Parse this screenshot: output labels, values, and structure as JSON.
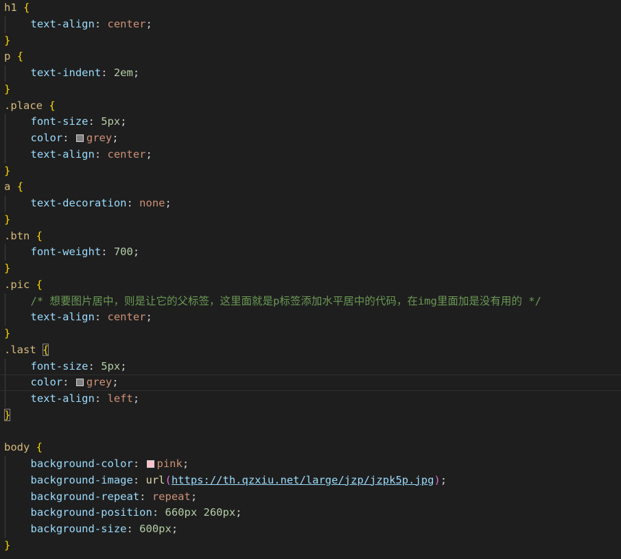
{
  "editor": {
    "swatch_colors": {
      "grey": "#808080",
      "pink": "#ffc0cb"
    },
    "lines": {
      "l1": {
        "sel": "h1",
        "brace": "{"
      },
      "l2": {
        "prop": "text-align",
        "colon": ":",
        "value": "center",
        "semi": ";"
      },
      "l3": {
        "brace": "}"
      },
      "l4": {
        "sel": "p",
        "brace": "{"
      },
      "l5": {
        "prop": "text-indent",
        "colon": ":",
        "value": "2em",
        "semi": ";"
      },
      "l6": {
        "brace": "}"
      },
      "l7": {
        "sel": ".place",
        "brace": "{"
      },
      "l8": {
        "prop": "font-size",
        "colon": ":",
        "value": "5px",
        "semi": ";"
      },
      "l9": {
        "prop": "color",
        "colon": ":",
        "value": "grey",
        "semi": ";"
      },
      "l10": {
        "prop": "text-align",
        "colon": ":",
        "value": "center",
        "semi": ";"
      },
      "l11": {
        "brace": "}"
      },
      "l12": {
        "sel": "a",
        "brace": "{"
      },
      "l13": {
        "prop": "text-decoration",
        "colon": ":",
        "value": "none",
        "semi": ";"
      },
      "l14": {
        "brace": "}"
      },
      "l15": {
        "sel": ".btn",
        "brace": "{"
      },
      "l16": {
        "prop": "font-weight",
        "colon": ":",
        "value": "700",
        "semi": ";"
      },
      "l17": {
        "brace": "}"
      },
      "l18": {
        "sel": ".pic",
        "brace": "{"
      },
      "l19": {
        "comment": "/* 想要图片居中，则是让它的父标签，这里面就是p标签添加水平居中的代码，在img里面加是没有用的 */"
      },
      "l20": {
        "prop": "text-align",
        "colon": ":",
        "value": "center",
        "semi": ";"
      },
      "l21": {
        "brace": "}"
      },
      "l22": {
        "sel": ".last",
        "brace": "{"
      },
      "l23": {
        "prop": "font-size",
        "colon": ":",
        "value": "5px",
        "semi": ";"
      },
      "l24": {
        "prop": "color",
        "colon": ":",
        "value": "grey",
        "semi": ";"
      },
      "l25": {
        "prop": "text-align",
        "colon": ":",
        "value": "left",
        "semi": ";"
      },
      "l26": {
        "brace": "}"
      },
      "l27": {},
      "l28": {
        "sel": "body",
        "brace": "{"
      },
      "l29": {
        "prop": "background-color",
        "colon": ":",
        "value": "pink",
        "semi": ";"
      },
      "l30": {
        "prop": "background-image",
        "colon": ":",
        "fn": "url",
        "open": "(",
        "url": "https://th.qzxiu.net/large/jzp/jzpk5p.jpg",
        "close": ")",
        "semi": ";"
      },
      "l31": {
        "prop": "background-repeat",
        "colon": ":",
        "value": "repeat",
        "semi": ";"
      },
      "l32": {
        "prop": "background-position",
        "colon": ":",
        "value": "660px 260px",
        "semi": ";"
      },
      "l33": {
        "prop": "background-size",
        "colon": ":",
        "value": "600px",
        "semi": ";"
      },
      "l34": {
        "brace": "}"
      }
    }
  }
}
